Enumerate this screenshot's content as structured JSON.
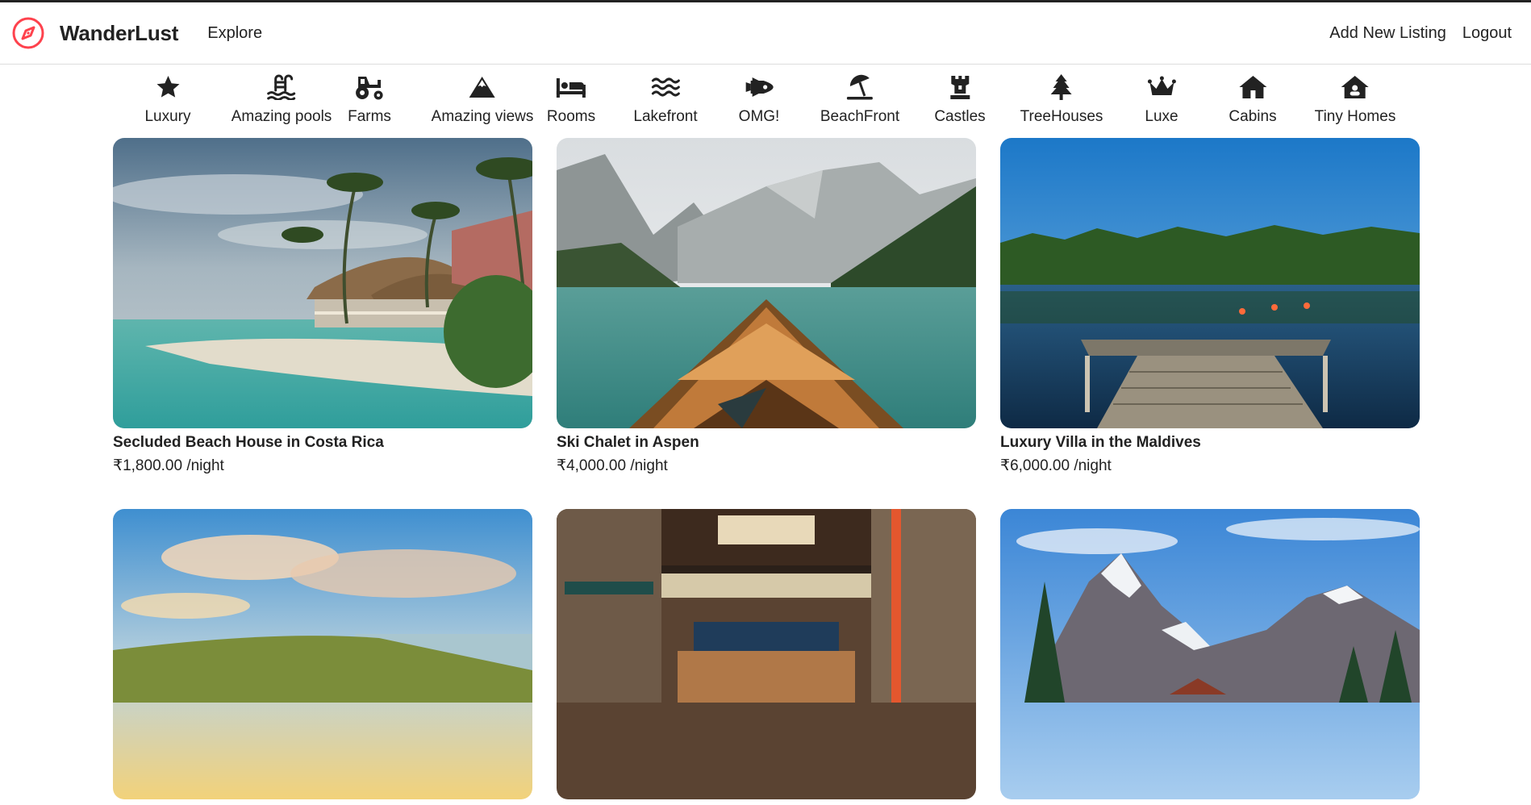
{
  "brand": {
    "name": "WanderLust",
    "icon": "compass-icon",
    "accent": "#fe424d"
  },
  "nav": {
    "explore": "Explore",
    "add_listing": "Add New Listing",
    "logout": "Logout"
  },
  "filters": [
    {
      "label": "Luxury",
      "icon": "star-icon"
    },
    {
      "label": "Amazing pools",
      "icon": "pool-icon"
    },
    {
      "label": "Farms",
      "icon": "tractor-icon"
    },
    {
      "label": "Amazing views",
      "icon": "mountain-icon"
    },
    {
      "label": "Rooms",
      "icon": "bed-icon"
    },
    {
      "label": "Lakefront",
      "icon": "water-icon"
    },
    {
      "label": "OMG!",
      "icon": "spaceship-icon"
    },
    {
      "label": "BeachFront",
      "icon": "umbrella-beach-icon"
    },
    {
      "label": "Castles",
      "icon": "chess-rook-icon"
    },
    {
      "label": "TreeHouses",
      "icon": "tree-icon"
    },
    {
      "label": "Luxe",
      "icon": "crown-icon"
    },
    {
      "label": "Cabins",
      "icon": "house-icon"
    },
    {
      "label": "Tiny Homes",
      "icon": "small-house-icon"
    }
  ],
  "listings": [
    {
      "title": "Secluded Beach House in Costa Rica",
      "price": "₹1,800.00 /night",
      "image": "beach-house-photo"
    },
    {
      "title": "Ski Chalet in Aspen",
      "price": "₹4,000.00 /night",
      "image": "mountain-lake-boat-photo"
    },
    {
      "title": "Luxury Villa in the Maldives",
      "price": "₹6,000.00 /night",
      "image": "lake-dock-photo"
    },
    {
      "title": "",
      "price": "",
      "image": "camping-field-photo"
    },
    {
      "title": "",
      "price": "",
      "image": "japanese-shop-photo"
    },
    {
      "title": "",
      "price": "",
      "image": "snowy-mountain-photo"
    }
  ]
}
